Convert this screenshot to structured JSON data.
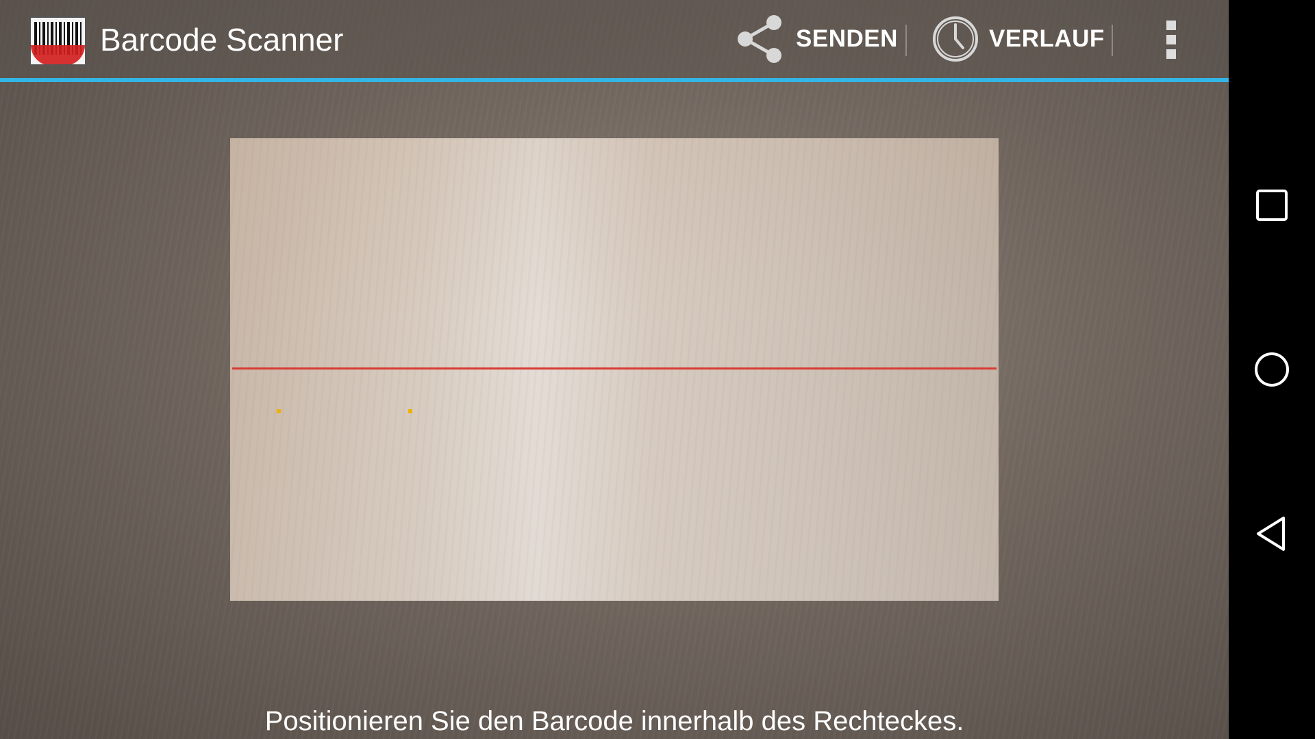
{
  "app": {
    "title": "Barcode Scanner",
    "logo_icon": "barcode-scanner-logo-icon"
  },
  "toolbar": {
    "share_label": "SENDEN",
    "share_icon": "share-icon",
    "history_label": "VERLAUF",
    "history_icon": "clock-icon",
    "overflow_icon": "overflow-menu-icon"
  },
  "colors": {
    "accent": "#33b5e5",
    "laser": "#d83a32",
    "result_points": "#f0b000"
  },
  "scanner": {
    "status_text": "Positionieren Sie den Barcode innerhalb des Rechteckes."
  },
  "navigation": {
    "recents_icon": "square-icon",
    "home_icon": "circle-icon",
    "back_icon": "triangle-back-icon"
  }
}
